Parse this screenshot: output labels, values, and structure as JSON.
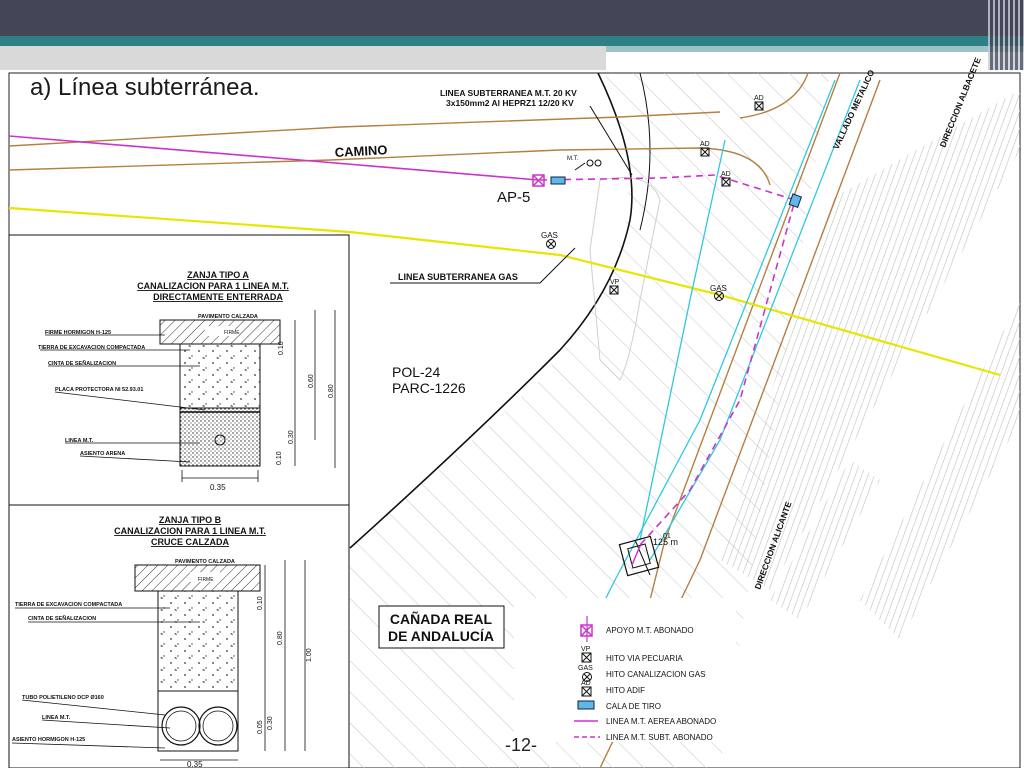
{
  "slide": {
    "title": "a) Línea subterránea.",
    "page_number": "-12-"
  },
  "plan": {
    "line_label_1": "LINEA SUBTERRANEA M.T. 20 KV",
    "line_label_2": "3x150mm2 Al HEPRZ1 12/20 KV",
    "camino": "CAMINO",
    "mt": "M.T.",
    "ap5": "AP-5",
    "gas": "GAS",
    "vp": "VP",
    "ad": "AD",
    "gas_line_label": "LINEA SUBTERRANEA GAS",
    "pol": "POL-24",
    "parc": "PARC-1226",
    "vallado": "VALLADO METALICO",
    "dir_albacete": "DIRECCION ALBACETE",
    "dir_alicante": "DIRECCION ALICANTE",
    "cala_code": "01",
    "cala_len": "125 m",
    "canada_1": "CAÑADA REAL",
    "canada_2": "DE ANDALUCÍA"
  },
  "zanja_a": {
    "title_1": "ZANJA TIPO A",
    "title_2": "CANALIZACION PARA 1 LINEA M.T.",
    "title_3": "DIRECTAMENTE ENTERRADA",
    "pavimento": "PAVIMENTO CALZADA",
    "firme_tag": "FIRME",
    "firme": "FIRME HORMIGON H-125",
    "tierra": "TIERRA DE EXCAVACION COMPACTADA",
    "cinta": "CINTA DE SEÑALIZACION",
    "placa": "PLACA PROTECTORA NI 52.93.01",
    "linea": "LINEA M.T.",
    "asiento": "ASIENTO ARENA",
    "d010a": "0.10",
    "d060": "0.60",
    "d080": "0.80",
    "d030": "0.30",
    "d010b": "0.10",
    "width": "0.35"
  },
  "zanja_b": {
    "title_1": "ZANJA TIPO B",
    "title_2": "CANALIZACION PARA 1 LINEA M.T.",
    "title_3": "CRUCE CALZADA",
    "pavimento": "PAVIMENTO CALZADA",
    "firme_tag": "FIRME",
    "tierra": "TIERRA DE EXCAVACION COMPACTADA",
    "cinta": "CINTA DE SEÑALIZACION",
    "tubo": "TUBO POLIETILENO DCP Ø160",
    "linea": "LINEA M.T.",
    "asiento": "ASIENTO HORMIGON H-125",
    "d010": "0.10",
    "d080": "0.80",
    "d100": "1.00",
    "d005": "0.05",
    "d030": "0.30",
    "width": "0.35"
  },
  "legend": {
    "apoyo": "APOYO M.T. ABONADO",
    "vp_tag": "VP",
    "hito_via": "HITO VIA PECUARIA",
    "gas_tag": "GAS",
    "hito_gas": "HITO CANALIZACION GAS",
    "ad_tag": "AD",
    "hito_adif": "HITO ADIF",
    "cala": "CALA DE TIRO",
    "aerea": "LINEA M.T. AEREA ABONADO",
    "subt": "LINEA M.T. SUBT. ABONADO"
  },
  "colors": {
    "header": "#424657",
    "teal": "#2f7f86",
    "road": "#b5803f",
    "gas_line": "#e6e600",
    "mt_aerea": "#cc33cc",
    "rail": "#2ec8e0"
  }
}
